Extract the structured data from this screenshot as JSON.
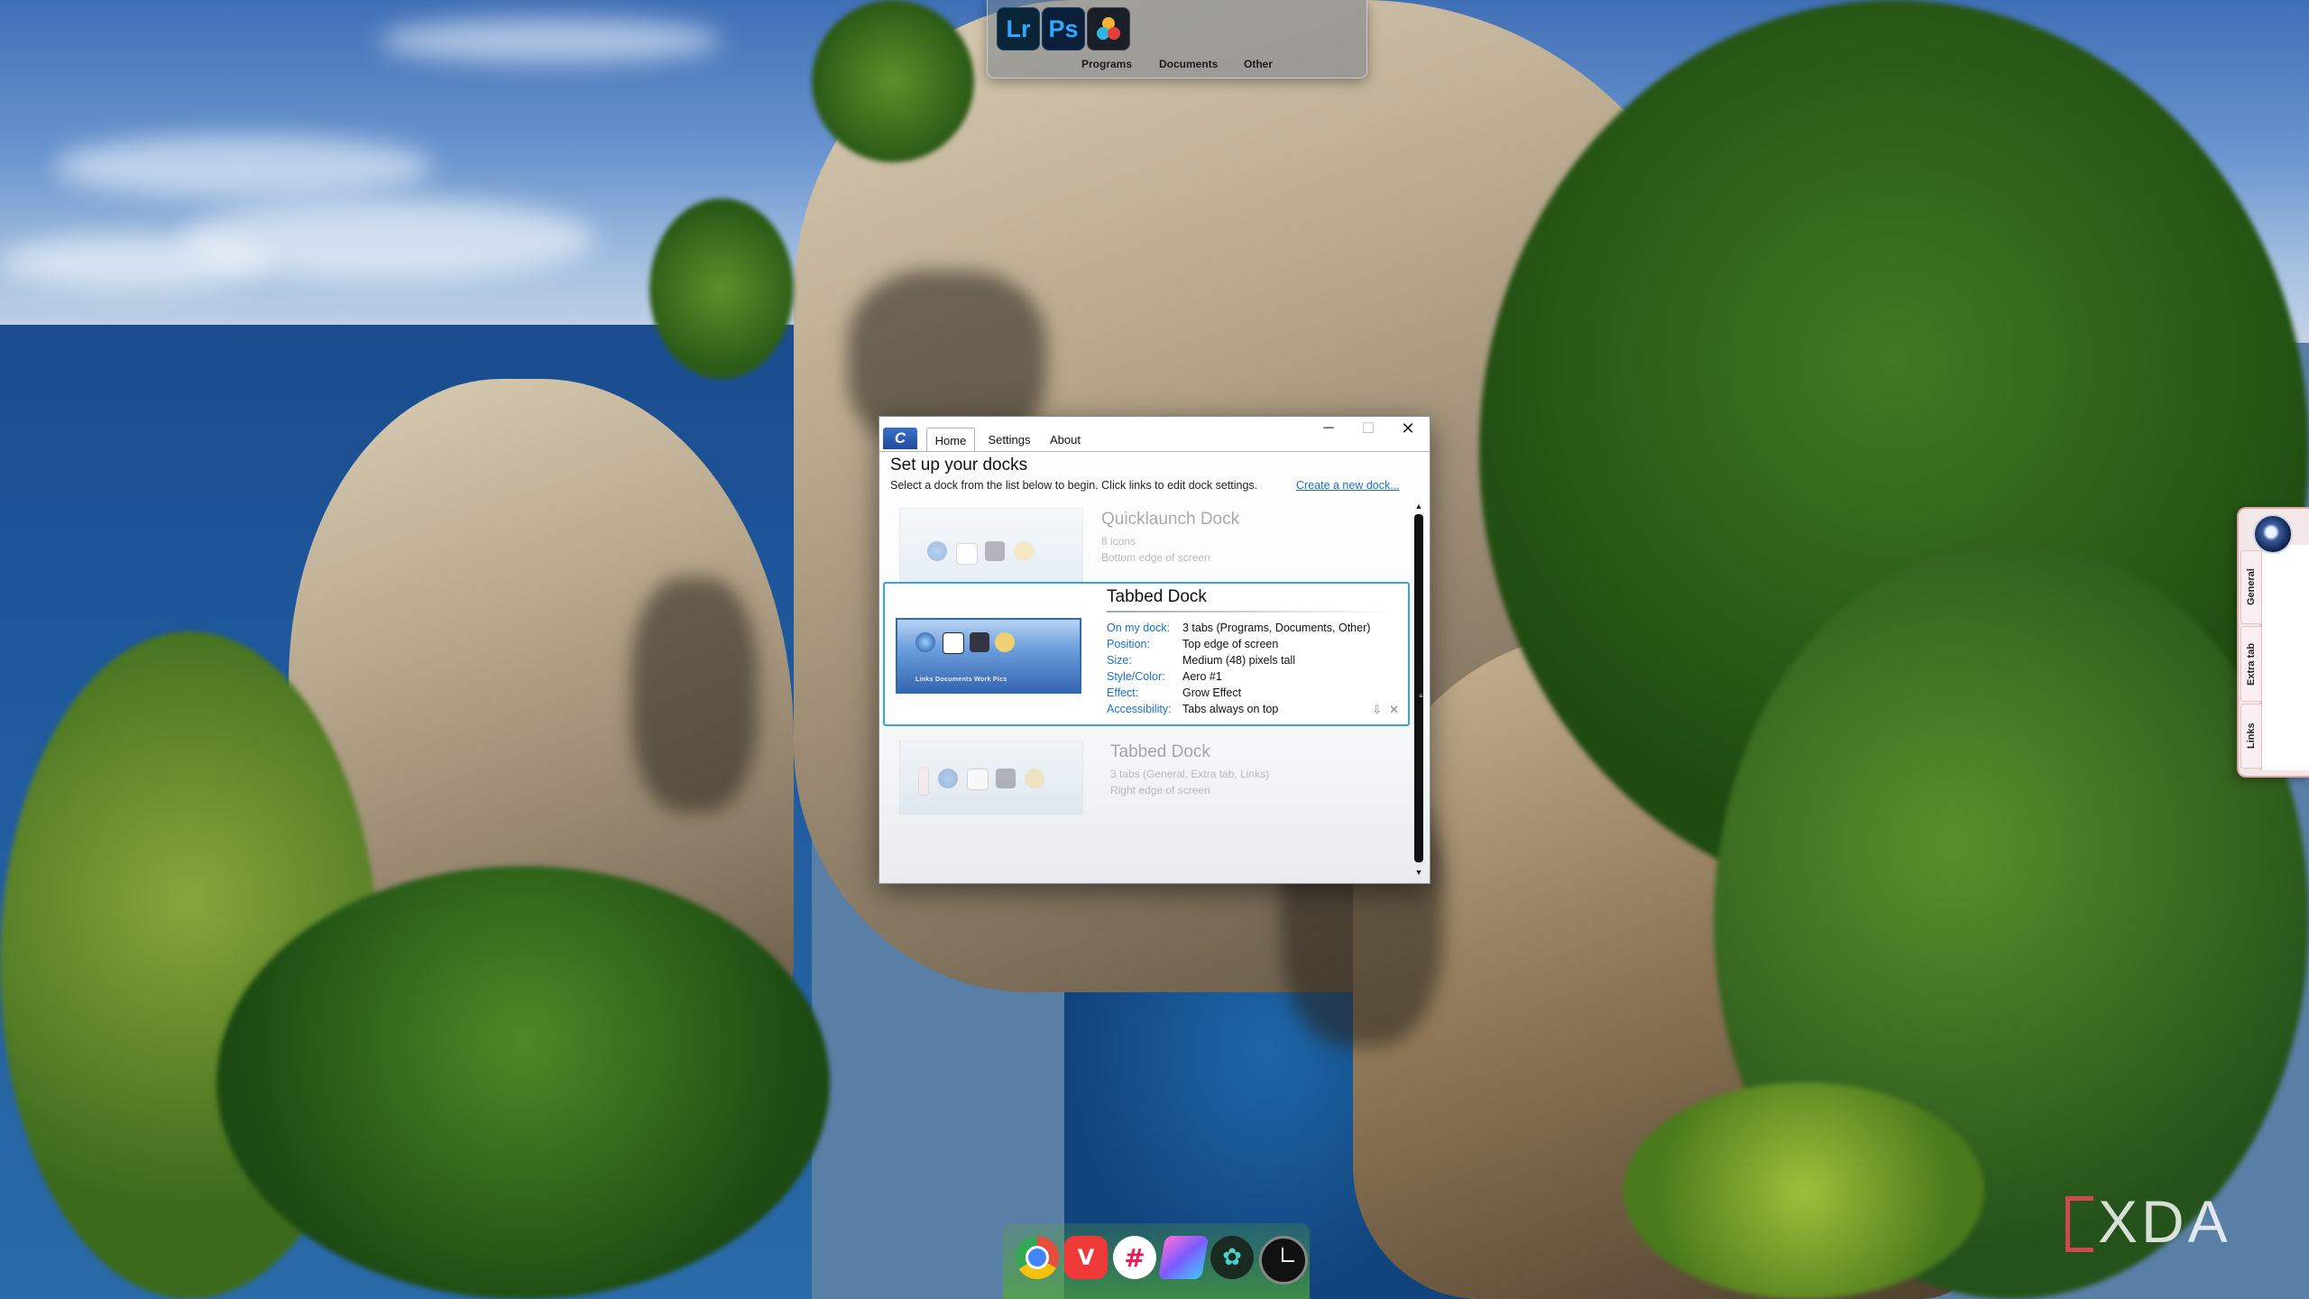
{
  "window": {
    "app_badge": "C",
    "tabs": [
      "Home",
      "Settings",
      "About"
    ],
    "minimize_glyph": "─",
    "maximize_glyph": "☐",
    "close_glyph": "✕",
    "heading": "Set up your docks",
    "subtext": "Select a dock from the list below to begin. Click links to edit dock settings.",
    "new_dock_link": "Create a new dock...",
    "docks": [
      {
        "title": "Quicklaunch Dock",
        "line1": "8 icons",
        "line2": "Bottom edge of screen"
      },
      {
        "title": "Tabbed Dock",
        "details": [
          {
            "label": "On my dock:",
            "value": "3 tabs (Programs, Documents, Other)"
          },
          {
            "label": "Position:",
            "value": "Top edge of screen"
          },
          {
            "label": "Size:",
            "value": "Medium (48) pixels tall"
          },
          {
            "label": "Style/Color:",
            "value": "Aero #1"
          },
          {
            "label": "Effect:",
            "value": "Grow Effect"
          },
          {
            "label": "Accessibility:",
            "value": "Tabs always on top"
          }
        ],
        "thumb_tabs": "Links   Documents   Work   Pics",
        "actions": [
          "⇩",
          "✕"
        ]
      },
      {
        "title": "Tabbed Dock",
        "line1": "3 tabs (General, Extra tab, Links)",
        "line2": "Right edge of screen"
      }
    ]
  },
  "top_dock": {
    "apps": [
      {
        "name": "Lightroom",
        "label": "Lr",
        "icon": "lightroom-icon"
      },
      {
        "name": "Photoshop",
        "label": "Ps",
        "icon": "photoshop-icon"
      },
      {
        "name": "DaVinci Resolve",
        "label": "",
        "icon": "davinci-resolve-icon"
      }
    ],
    "tabs": [
      "Programs",
      "Documents",
      "Other"
    ]
  },
  "right_dock": {
    "tabs": [
      "General",
      "Extra tab",
      "Links"
    ]
  },
  "bottom_dock": {
    "icons": [
      "chrome-icon",
      "vivaldi-icon",
      "slack-icon",
      "feather-icon",
      "resolve-icon",
      "clock-icon"
    ]
  },
  "watermark": "XDA",
  "colors": {
    "accent_link": "#1a6fd1",
    "selection_border": "#37a3e0",
    "watermark_bracket": "#eb465a"
  }
}
